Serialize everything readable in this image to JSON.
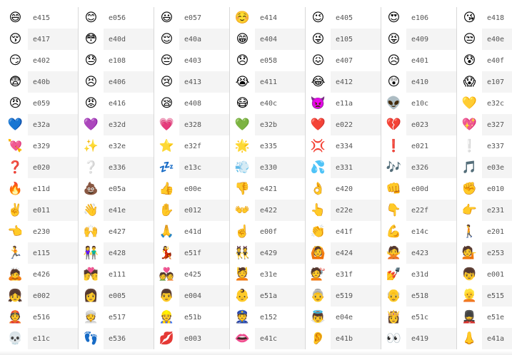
{
  "rows": [
    [
      {
        "emoji": "😄",
        "code": "e415",
        "icon": "smiling-face-icon"
      },
      {
        "emoji": "😊",
        "code": "e056",
        "icon": "blushing-face-icon"
      },
      {
        "emoji": "😃",
        "code": "e057",
        "icon": "grinning-face-icon"
      },
      {
        "emoji": "☺️",
        "code": "e414",
        "icon": "relaxed-face-icon"
      },
      {
        "emoji": "😉",
        "code": "e405",
        "icon": "winking-face-icon"
      },
      {
        "emoji": "😍",
        "code": "e106",
        "icon": "heart-eyes-face-icon"
      },
      {
        "emoji": "😘",
        "code": "e418",
        "icon": "kissing-heart-face-icon"
      }
    ],
    [
      {
        "emoji": "😚",
        "code": "e417",
        "icon": "kissing-face-icon"
      },
      {
        "emoji": "😳",
        "code": "e40d",
        "icon": "flushed-face-icon"
      },
      {
        "emoji": "😌",
        "code": "e40a",
        "icon": "relieved-face-icon"
      },
      {
        "emoji": "😁",
        "code": "e404",
        "icon": "beaming-face-icon"
      },
      {
        "emoji": "😜",
        "code": "e105",
        "icon": "tongue-wink-face-icon"
      },
      {
        "emoji": "😝",
        "code": "e409",
        "icon": "squinting-tongue-face-icon"
      },
      {
        "emoji": "😒",
        "code": "e40e",
        "icon": "unamused-face-icon"
      }
    ],
    [
      {
        "emoji": "😏",
        "code": "e402",
        "icon": "smirking-face-icon"
      },
      {
        "emoji": "😓",
        "code": "e108",
        "icon": "sweat-face-icon"
      },
      {
        "emoji": "😔",
        "code": "e403",
        "icon": "pensive-face-icon"
      },
      {
        "emoji": "😞",
        "code": "e058",
        "icon": "disappointed-face-icon"
      },
      {
        "emoji": "😖",
        "code": "e407",
        "icon": "confounded-face-icon"
      },
      {
        "emoji": "😥",
        "code": "e401",
        "icon": "sad-relieved-face-icon"
      },
      {
        "emoji": "😰",
        "code": "e40f",
        "icon": "anxious-sweat-face-icon"
      }
    ],
    [
      {
        "emoji": "😨",
        "code": "e40b",
        "icon": "fearful-face-icon"
      },
      {
        "emoji": "😣",
        "code": "e406",
        "icon": "persevering-face-icon"
      },
      {
        "emoji": "😢",
        "code": "e413",
        "icon": "crying-face-icon"
      },
      {
        "emoji": "😭",
        "code": "e411",
        "icon": "loudly-crying-face-icon"
      },
      {
        "emoji": "😂",
        "code": "e412",
        "icon": "tears-of-joy-face-icon"
      },
      {
        "emoji": "😲",
        "code": "e410",
        "icon": "astonished-face-icon"
      },
      {
        "emoji": "😱",
        "code": "e107",
        "icon": "screaming-face-icon"
      }
    ],
    [
      {
        "emoji": "😠",
        "code": "e059",
        "icon": "angry-face-icon"
      },
      {
        "emoji": "😡",
        "code": "e416",
        "icon": "pouting-face-icon"
      },
      {
        "emoji": "😪",
        "code": "e408",
        "icon": "sleepy-face-icon"
      },
      {
        "emoji": "😷",
        "code": "e40c",
        "icon": "medical-mask-face-icon"
      },
      {
        "emoji": "👿",
        "code": "e11a",
        "icon": "imp-icon"
      },
      {
        "emoji": "👽",
        "code": "e10c",
        "icon": "alien-icon"
      },
      {
        "emoji": "💛",
        "code": "e32c",
        "icon": "yellow-heart-icon"
      }
    ],
    [
      {
        "emoji": "💙",
        "code": "e32a",
        "icon": "blue-heart-icon"
      },
      {
        "emoji": "💜",
        "code": "e32d",
        "icon": "purple-heart-icon"
      },
      {
        "emoji": "💗",
        "code": "e328",
        "icon": "pink-heart-icon"
      },
      {
        "emoji": "💚",
        "code": "e32b",
        "icon": "green-heart-icon"
      },
      {
        "emoji": "❤️",
        "code": "e022",
        "icon": "red-heart-icon"
      },
      {
        "emoji": "💔",
        "code": "e023",
        "icon": "broken-heart-icon"
      },
      {
        "emoji": "💖",
        "code": "e327",
        "icon": "sparkling-heart-icon"
      }
    ],
    [
      {
        "emoji": "💘",
        "code": "e329",
        "icon": "heart-with-arrow-icon"
      },
      {
        "emoji": "✨",
        "code": "e32e",
        "icon": "sparkles-icon"
      },
      {
        "emoji": "⭐",
        "code": "e32f",
        "icon": "star-icon"
      },
      {
        "emoji": "🌟",
        "code": "e335",
        "icon": "glowing-star-icon"
      },
      {
        "emoji": "💢",
        "code": "e334",
        "icon": "anger-symbol-icon"
      },
      {
        "emoji": "❗",
        "code": "e021",
        "icon": "exclamation-icon"
      },
      {
        "emoji": "❕",
        "code": "e337",
        "icon": "exclamation-icon"
      }
    ],
    [
      {
        "emoji": "❓",
        "code": "e020",
        "icon": "question-mark-icon"
      },
      {
        "emoji": "❔",
        "code": "e336",
        "icon": "question-mark-icon"
      },
      {
        "emoji": "💤",
        "code": "e13c",
        "icon": "zzz-icon"
      },
      {
        "emoji": "💨",
        "code": "e330",
        "icon": "dash-icon"
      },
      {
        "emoji": "💦",
        "code": "e331",
        "icon": "sweat-droplets-icon"
      },
      {
        "emoji": "🎶",
        "code": "e326",
        "icon": "musical-notes-icon"
      },
      {
        "emoji": "🎵",
        "code": "e03e",
        "icon": "musical-note-icon"
      }
    ],
    [
      {
        "emoji": "🔥",
        "code": "e11d",
        "icon": "fire-icon"
      },
      {
        "emoji": "💩",
        "code": "e05a",
        "icon": "poo-icon"
      },
      {
        "emoji": "👍",
        "code": "e00e",
        "icon": "thumbs-up-icon"
      },
      {
        "emoji": "👎",
        "code": "e421",
        "icon": "thumbs-down-icon"
      },
      {
        "emoji": "👌",
        "code": "e420",
        "icon": "ok-hand-icon"
      },
      {
        "emoji": "👊",
        "code": "e00d",
        "icon": "fist-bump-icon"
      },
      {
        "emoji": "✊",
        "code": "e010",
        "icon": "raised-fist-icon"
      }
    ],
    [
      {
        "emoji": "✌️",
        "code": "e011",
        "icon": "victory-hand-icon"
      },
      {
        "emoji": "👋",
        "code": "e41e",
        "icon": "waving-hand-icon"
      },
      {
        "emoji": "✋",
        "code": "e012",
        "icon": "raised-hand-icon"
      },
      {
        "emoji": "👐",
        "code": "e422",
        "icon": "open-hands-icon"
      },
      {
        "emoji": "👆",
        "code": "e22e",
        "icon": "point-up-icon"
      },
      {
        "emoji": "👇",
        "code": "e22f",
        "icon": "point-down-icon"
      },
      {
        "emoji": "👉",
        "code": "e231",
        "icon": "point-right-icon"
      }
    ],
    [
      {
        "emoji": "👈",
        "code": "e230",
        "icon": "point-left-icon"
      },
      {
        "emoji": "🙌",
        "code": "e427",
        "icon": "raised-hands-icon"
      },
      {
        "emoji": "🙏",
        "code": "e41d",
        "icon": "folded-hands-icon"
      },
      {
        "emoji": "☝️",
        "code": "e00f",
        "icon": "index-up-icon"
      },
      {
        "emoji": "👏",
        "code": "e41f",
        "icon": "clapping-hands-icon"
      },
      {
        "emoji": "💪",
        "code": "e14c",
        "icon": "flexed-biceps-icon"
      },
      {
        "emoji": "🚶",
        "code": "e201",
        "icon": "walking-person-icon"
      }
    ],
    [
      {
        "emoji": "🏃",
        "code": "e115",
        "icon": "running-person-icon"
      },
      {
        "emoji": "👫",
        "code": "e428",
        "icon": "couple-icon"
      },
      {
        "emoji": "💃",
        "code": "e51f",
        "icon": "dancer-icon"
      },
      {
        "emoji": "👯",
        "code": "e429",
        "icon": "bunny-dancers-icon"
      },
      {
        "emoji": "🙆",
        "code": "e424",
        "icon": "ok-gesture-person-icon"
      },
      {
        "emoji": "🙅",
        "code": "e423",
        "icon": "no-gesture-person-icon"
      },
      {
        "emoji": "💁",
        "code": "e253",
        "icon": "info-desk-person-icon"
      }
    ],
    [
      {
        "emoji": "🙇",
        "code": "e426",
        "icon": "bowing-person-icon"
      },
      {
        "emoji": "💏",
        "code": "e111",
        "icon": "kiss-couple-icon"
      },
      {
        "emoji": "💑",
        "code": "e425",
        "icon": "couple-with-heart-icon"
      },
      {
        "emoji": "💆",
        "code": "e31e",
        "icon": "face-massage-icon"
      },
      {
        "emoji": "💇",
        "code": "e31f",
        "icon": "haircut-icon"
      },
      {
        "emoji": "💅",
        "code": "e31d",
        "icon": "nail-polish-icon"
      },
      {
        "emoji": "👦",
        "code": "e001",
        "icon": "boy-icon"
      }
    ],
    [
      {
        "emoji": "👧",
        "code": "e002",
        "icon": "girl-icon"
      },
      {
        "emoji": "👩",
        "code": "e005",
        "icon": "woman-icon"
      },
      {
        "emoji": "👨",
        "code": "e004",
        "icon": "man-icon"
      },
      {
        "emoji": "👶",
        "code": "e51a",
        "icon": "baby-icon"
      },
      {
        "emoji": "👵",
        "code": "e519",
        "icon": "old-woman-icon"
      },
      {
        "emoji": "👴",
        "code": "e518",
        "icon": "old-man-icon"
      },
      {
        "emoji": "👱",
        "code": "e515",
        "icon": "blond-person-icon"
      }
    ],
    [
      {
        "emoji": "👲",
        "code": "e516",
        "icon": "man-with-cap-icon"
      },
      {
        "emoji": "👳",
        "code": "e517",
        "icon": "man-with-turban-icon"
      },
      {
        "emoji": "👷",
        "code": "e51b",
        "icon": "construction-worker-icon"
      },
      {
        "emoji": "👮",
        "code": "e152",
        "icon": "police-officer-icon"
      },
      {
        "emoji": "👼",
        "code": "e04e",
        "icon": "angel-icon"
      },
      {
        "emoji": "👸",
        "code": "e51c",
        "icon": "princess-icon"
      },
      {
        "emoji": "💂",
        "code": "e51e",
        "icon": "guard-icon"
      }
    ],
    [
      {
        "emoji": "💀",
        "code": "e11c",
        "icon": "skull-icon"
      },
      {
        "emoji": "👣",
        "code": "e536",
        "icon": "footprints-icon"
      },
      {
        "emoji": "💋",
        "code": "e003",
        "icon": "kiss-mark-icon"
      },
      {
        "emoji": "👄",
        "code": "e41c",
        "icon": "mouth-icon"
      },
      {
        "emoji": "👂",
        "code": "e41b",
        "icon": "ear-icon"
      },
      {
        "emoji": "👀",
        "code": "e419",
        "icon": "eyes-icon"
      },
      {
        "emoji": "👃",
        "code": "e41a",
        "icon": "nose-icon"
      }
    ]
  ]
}
